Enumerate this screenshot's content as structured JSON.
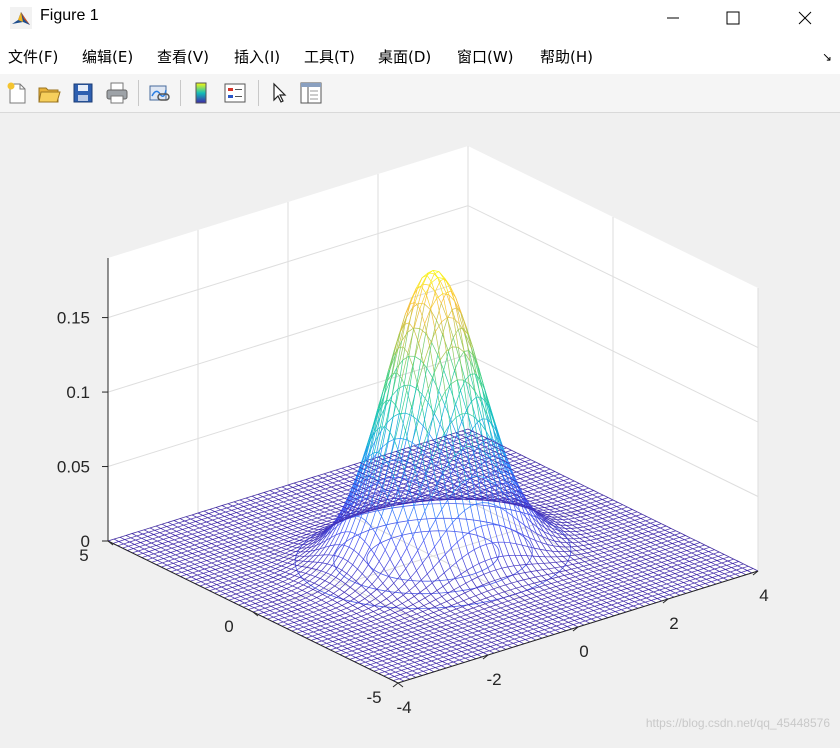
{
  "window": {
    "title": "Figure 1",
    "icon": "matlab-icon",
    "controls": [
      "minimize-icon",
      "maximize-icon",
      "close-icon"
    ]
  },
  "menubar": {
    "items": [
      "文件(F)",
      "编辑(E)",
      "查看(V)",
      "插入(I)",
      "工具(T)",
      "桌面(D)",
      "窗口(W)",
      "帮助(H)"
    ],
    "dock_arrow": "↘"
  },
  "toolbar": {
    "buttons": [
      {
        "name": "new-figure-icon"
      },
      {
        "name": "open-file-icon"
      },
      {
        "name": "save-icon"
      },
      {
        "name": "print-icon"
      },
      {
        "name": "link-plot-icon"
      },
      {
        "name": "insert-colorbar-icon"
      },
      {
        "name": "insert-legend-icon"
      },
      {
        "name": "edit-plot-icon"
      },
      {
        "name": "property-inspector-icon"
      }
    ]
  },
  "chart_data": {
    "type": "surface-mesh",
    "function": "bivariate normal density, peak about 0.19 at (0,0), with contour lines on the floor",
    "x_ticks": [
      -4,
      -2,
      0,
      2,
      4
    ],
    "y_ticks": [
      -5,
      0,
      5
    ],
    "z_ticks": [
      0,
      0.05,
      0.1,
      0.15
    ],
    "x_tick_labels": [
      "-4",
      "-2",
      "0",
      "2",
      "4"
    ],
    "y_tick_labels": [
      "-5",
      "0",
      "5"
    ],
    "z_tick_labels": [
      "0",
      "0.05",
      "0.1",
      "0.15"
    ],
    "xlim": [
      -4,
      4
    ],
    "ylim": [
      -5,
      5
    ],
    "zlim": [
      0,
      0.19
    ],
    "colormap": "parula",
    "colors": {
      "low": "#3e26a8",
      "mid": "#13beb8",
      "high": "#f9fb0e"
    },
    "grid": true,
    "view": "3d default"
  },
  "watermark": "https://blog.csdn.net/qq_45448576"
}
